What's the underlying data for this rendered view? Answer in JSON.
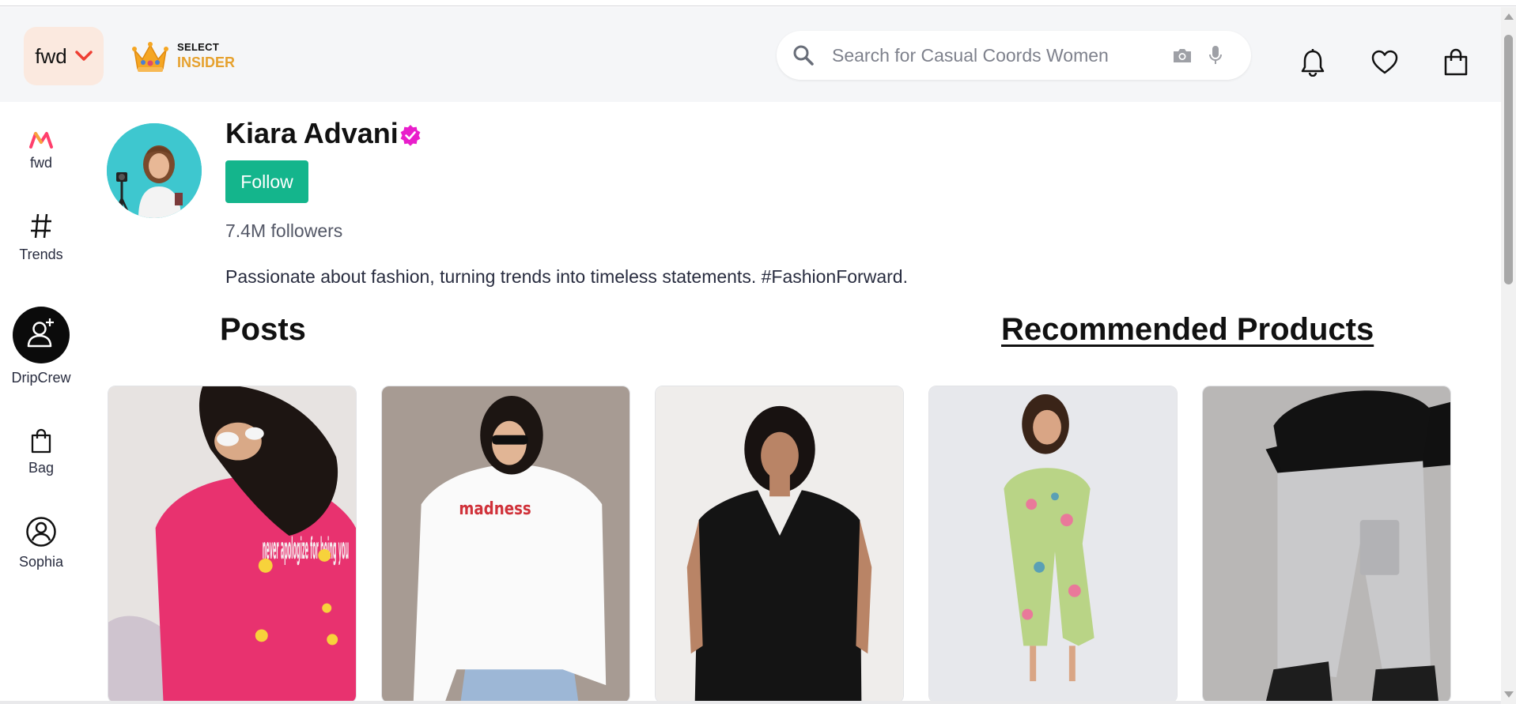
{
  "header": {
    "fwd_label": "fwd",
    "insider_top": "SELECT",
    "insider_bottom": "INSIDER",
    "search_placeholder": "Search for Casual Coords Women",
    "icons": [
      "notification-bell-icon",
      "wishlist-heart-icon",
      "shopping-bag-icon"
    ],
    "colors": {
      "fwd_chevron": "#ee3f33",
      "insider_text": "#e6a12e",
      "header_bg": "#f5f6f8",
      "fwd_pill_bg": "#fbe9df"
    }
  },
  "sidebar": {
    "items": [
      {
        "label": "fwd",
        "icon": "myntra-logo-icon"
      },
      {
        "label": "Trends",
        "icon": "hashtag-icon"
      },
      {
        "label": "DripCrew",
        "icon": "add-user-icon"
      },
      {
        "label": "Bag",
        "icon": "bag-icon"
      },
      {
        "label": "Sophia",
        "icon": "user-profile-icon"
      }
    ]
  },
  "profile": {
    "name": "Kiara Advani",
    "verified_icon": "verified-badge-icon",
    "follow_label": "Follow",
    "followers": "7.4M followers",
    "bio": "Passionate about fashion, turning trends into timeless statements. #FashionForward.",
    "colors": {
      "follow_bg": "#14b58c",
      "verified": "#e91ecb"
    }
  },
  "tabs": {
    "posts": "Posts",
    "recommended": "Recommended Products"
  },
  "products": [
    {
      "image": "pink oversized t-shirt with 'never apologize for being you' print",
      "print_text": "never apologize for being you"
    },
    {
      "image": "white oversized t-shirt with red 'madness' print",
      "print_text": "madness"
    },
    {
      "image": "black v-neck t-shirt"
    },
    {
      "image": "green floral midi dress"
    },
    {
      "image": "grey cargo jogger pants"
    }
  ]
}
